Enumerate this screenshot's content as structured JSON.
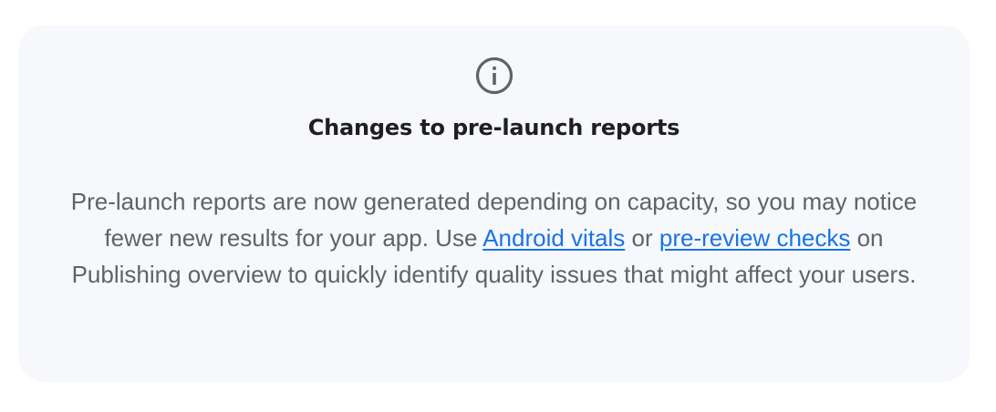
{
  "notice": {
    "icon": "info-icon",
    "title": "Changes to pre-launch reports",
    "text_part1": "Pre-launch reports are now generated depending on capacity, so you may notice fewer new results for your app. Use ",
    "link_android_vitals": "Android vitals",
    "text_part2": " or ",
    "link_pre_review_checks": "pre-review checks",
    "text_part3": " on Publishing overview to quickly identify quality issues that might affect your users."
  },
  "colors": {
    "card_background": "#f6f8fc",
    "title": "#1f1f1f",
    "body_text": "#5f6368",
    "link": "#1a73e8",
    "icon": "#5f6368"
  }
}
